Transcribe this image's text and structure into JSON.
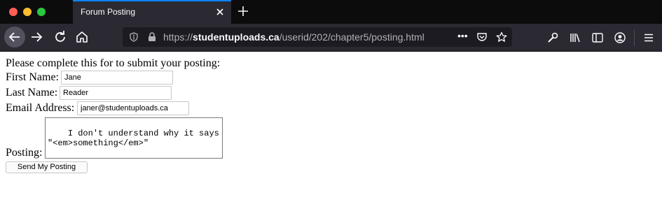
{
  "browser": {
    "tab_title": "Forum Posting",
    "url_scheme": "https://",
    "url_host": "studentuploads.ca",
    "url_path": "/userid/202/chapter5/posting.html",
    "page_actions": "•••",
    "tab_accent_color": "#0a84ff"
  },
  "form": {
    "intro": "Please complete this for to submit your posting:",
    "first_name_label": "First Name:",
    "first_name_value": "Jane",
    "last_name_label": "Last Name:",
    "last_name_value": "Reader",
    "email_label": "Email Address:",
    "email_value": "janer@studentuploads.ca",
    "posting_label": "Posting:",
    "posting_value": "I don't understand why it says \"<em>something</em>\"",
    "submit_label": "Send My Posting"
  }
}
